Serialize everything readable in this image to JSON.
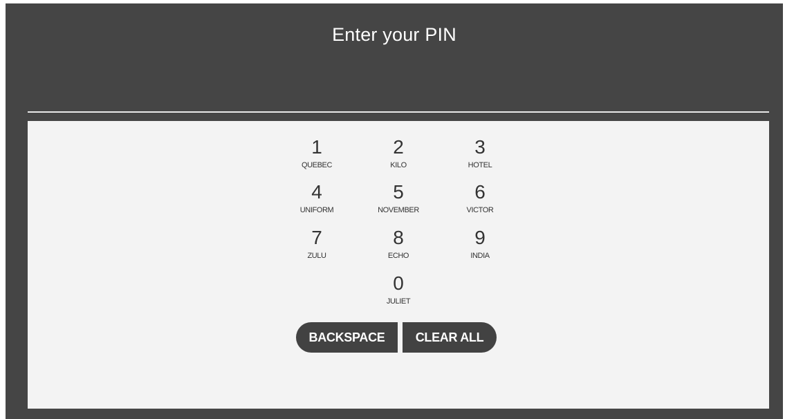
{
  "title": "Enter your PIN",
  "keypad": {
    "keys": [
      {
        "digit": "1",
        "word": "QUEBEC"
      },
      {
        "digit": "2",
        "word": "KILO"
      },
      {
        "digit": "3",
        "word": "HOTEL"
      },
      {
        "digit": "4",
        "word": "UNIFORM"
      },
      {
        "digit": "5",
        "word": "NOVEMBER"
      },
      {
        "digit": "6",
        "word": "VICTOR"
      },
      {
        "digit": "7",
        "word": "ZULU"
      },
      {
        "digit": "8",
        "word": "ECHO"
      },
      {
        "digit": "9",
        "word": "INDIA"
      },
      {
        "digit": "0",
        "word": "JULIET"
      }
    ]
  },
  "actions": {
    "backspace_label": "BACKSPACE",
    "clear_all_label": "CLEAR ALL"
  },
  "colors": {
    "frame_background": "#454545",
    "panel_background": "#f3f3f3",
    "button_background": "#424242",
    "title_text": "#ffffff"
  }
}
